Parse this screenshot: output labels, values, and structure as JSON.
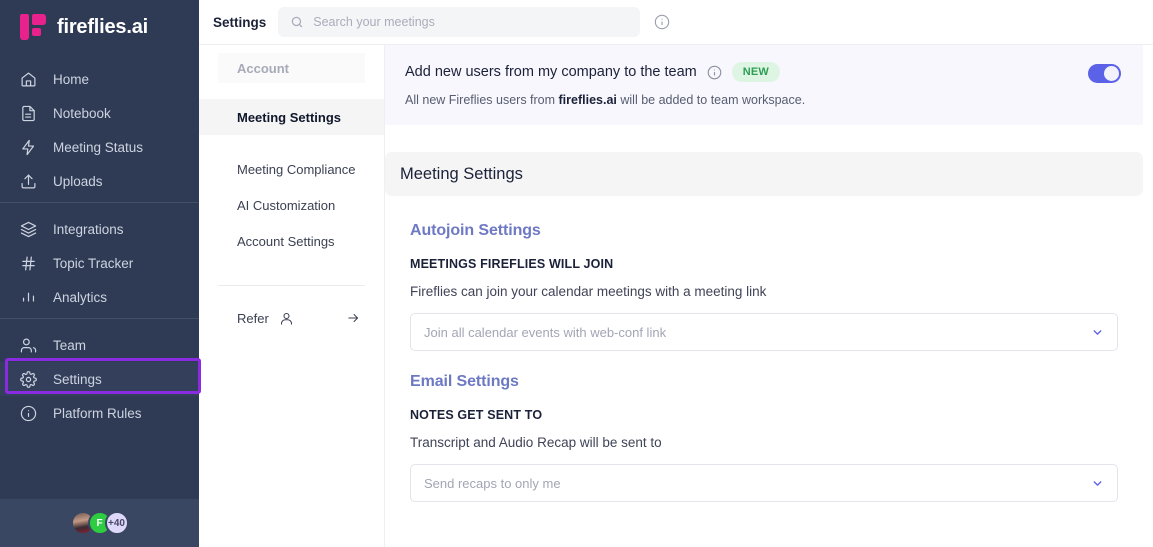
{
  "brand": {
    "name": "fireflies.ai",
    "logo_icon": "fireflies-logo-icon",
    "logo_color": "#e8218c",
    "sidebar_bg": "#2f3b55"
  },
  "sidebar": {
    "groups": [
      {
        "items": [
          {
            "label": "Home",
            "icon": "home-icon"
          },
          {
            "label": "Notebook",
            "icon": "notebook-icon"
          },
          {
            "label": "Meeting Status",
            "icon": "lightning-icon"
          },
          {
            "label": "Uploads",
            "icon": "upload-icon"
          }
        ]
      },
      {
        "items": [
          {
            "label": "Integrations",
            "icon": "layers-icon"
          },
          {
            "label": "Topic Tracker",
            "icon": "hash-icon"
          },
          {
            "label": "Analytics",
            "icon": "bar-chart-icon"
          }
        ]
      },
      {
        "items": [
          {
            "label": "Team",
            "icon": "users-icon"
          },
          {
            "label": "Settings",
            "icon": "gear-icon"
          },
          {
            "label": "Platform Rules",
            "icon": "info-circle-icon"
          }
        ]
      }
    ],
    "highlight": {
      "target": "Settings",
      "color": "#8a2be2"
    },
    "footer_avatars": [
      {
        "type": "photo",
        "label": ""
      },
      {
        "type": "initial",
        "label": "F",
        "color": "#2ecc40"
      },
      {
        "type": "count",
        "label": "+40",
        "color": "#ded9fb"
      }
    ]
  },
  "topbar": {
    "title": "Settings",
    "search": {
      "placeholder": "Search your meetings",
      "value": "",
      "icon": "search-icon"
    },
    "info_icon": "info-circle-icon"
  },
  "subnav": {
    "section_header": "Account",
    "items": [
      {
        "label": "Meeting Settings",
        "active": true
      },
      {
        "label": "Meeting Compliance",
        "active": false
      },
      {
        "label": "AI Customization",
        "active": false
      },
      {
        "label": "Account Settings",
        "active": false
      }
    ],
    "refer": {
      "label": "Refer",
      "user_icon": "user-icon",
      "arrow_icon": "arrow-right-icon"
    }
  },
  "banner": {
    "title": "Add new users from my company to the team",
    "info_icon": "info-circle-icon",
    "badge": "NEW",
    "badge_bg": "#dff5e4",
    "badge_color": "#2e9e54",
    "subtitle_pre": "All new Fireflies users from ",
    "subtitle_bold": "fireflies.ai",
    "subtitle_post": " will be added to team workspace.",
    "toggle": {
      "state": "on",
      "color": "#5b62e8"
    }
  },
  "main": {
    "card_title": "Meeting Settings",
    "sections": [
      {
        "title": "Autojoin Settings",
        "title_color": "#6e79c4",
        "label": "MEETINGS FIREFLIES WILL JOIN",
        "description": "Fireflies can join your calendar meetings with a meeting link",
        "select_value": "Join all calendar events with web-conf link",
        "select_icon": "chevron-down-icon"
      },
      {
        "title": "Email Settings",
        "title_color": "#6e79c4",
        "label": "NOTES GET SENT TO",
        "description": "Transcript and Audio Recap will be sent to",
        "select_value": "Send recaps to only me",
        "select_icon": "chevron-down-icon"
      }
    ]
  }
}
